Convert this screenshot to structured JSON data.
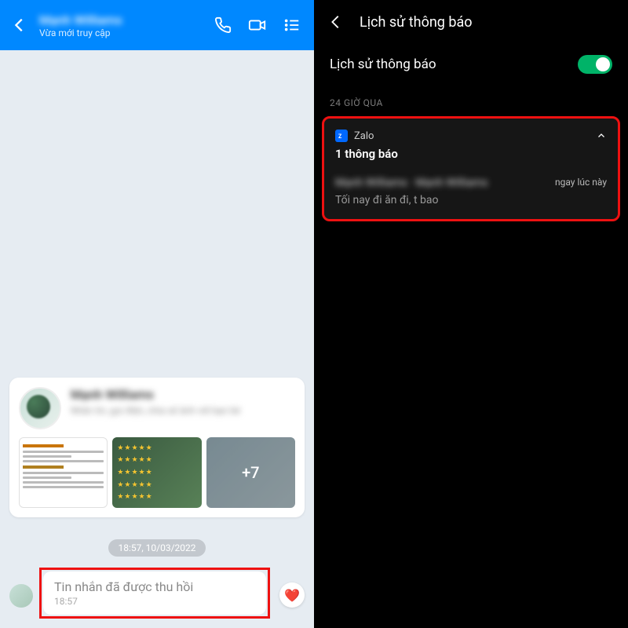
{
  "left": {
    "header": {
      "contact_name": "Mạnh Williams",
      "status": "Vừa mới truy cập"
    },
    "card": {
      "name": "Mạnh Williams",
      "desc": "Nhắn tin, gọi điện, chia sẻ ảnh với bạn bè",
      "more_label": "+7"
    },
    "timestamp": "18:57, 10/03/2022",
    "message": {
      "text": "Tin nhắn đã được thu hồi",
      "time": "18:57"
    }
  },
  "right": {
    "header_title": "Lịch sử thông báo",
    "setting_label": "Lịch sử thông báo",
    "section_label": "24 GIỜ QUA",
    "notif": {
      "app_name": "Zalo",
      "count_label": "1 thông báo",
      "sender": "Mạnh Williams · Mạnh Williams",
      "time": "ngay lúc này",
      "preview": "Tối nay đi ăn đi, t bao"
    }
  }
}
